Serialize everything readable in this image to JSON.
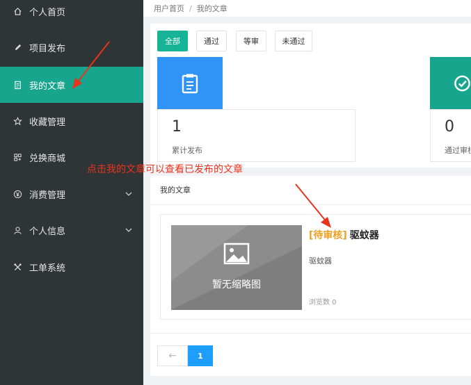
{
  "sidebar": {
    "items": [
      {
        "label": "个人首页",
        "icon": "home-icon"
      },
      {
        "label": "项目发布",
        "icon": "pencil-icon"
      },
      {
        "label": "我的文章",
        "icon": "document-icon",
        "active": true
      },
      {
        "label": "收藏管理",
        "icon": "star-icon"
      },
      {
        "label": "兑换商城",
        "icon": "grid-icon"
      },
      {
        "label": "消费管理",
        "icon": "yen-icon",
        "expandable": true
      },
      {
        "label": "个人信息",
        "icon": "user-icon",
        "expandable": true
      },
      {
        "label": "工单系统",
        "icon": "tools-icon"
      }
    ]
  },
  "breadcrumb": {
    "home": "用户首页",
    "separator": "/",
    "current": "我的文章"
  },
  "filters": [
    "全部",
    "通过",
    "等审",
    "未通过"
  ],
  "stats": [
    {
      "value": "1",
      "label": "累计发布",
      "icon": "clipboard-icon",
      "color": "#2f94f5"
    },
    {
      "value": "0",
      "label": "通过审核",
      "icon": "check-circle-icon",
      "color": "#17a58e"
    }
  ],
  "annotation": {
    "text": "点击我的文章可以查看已发布的文章",
    "color": "#e8341c"
  },
  "articles_panel": {
    "title": "我的文章",
    "article": {
      "thumbnail_text": "暂无缩略图",
      "status": "[待审核]",
      "title": "驱蚊器",
      "description": "驱蚊器",
      "views": "浏览数 0"
    }
  },
  "pagination": {
    "prev": "←",
    "current": "1"
  },
  "colors": {
    "accent": "#17b397",
    "sidebar": "#2f3437",
    "pager": "#1e9fff",
    "status": "#f0a020"
  }
}
